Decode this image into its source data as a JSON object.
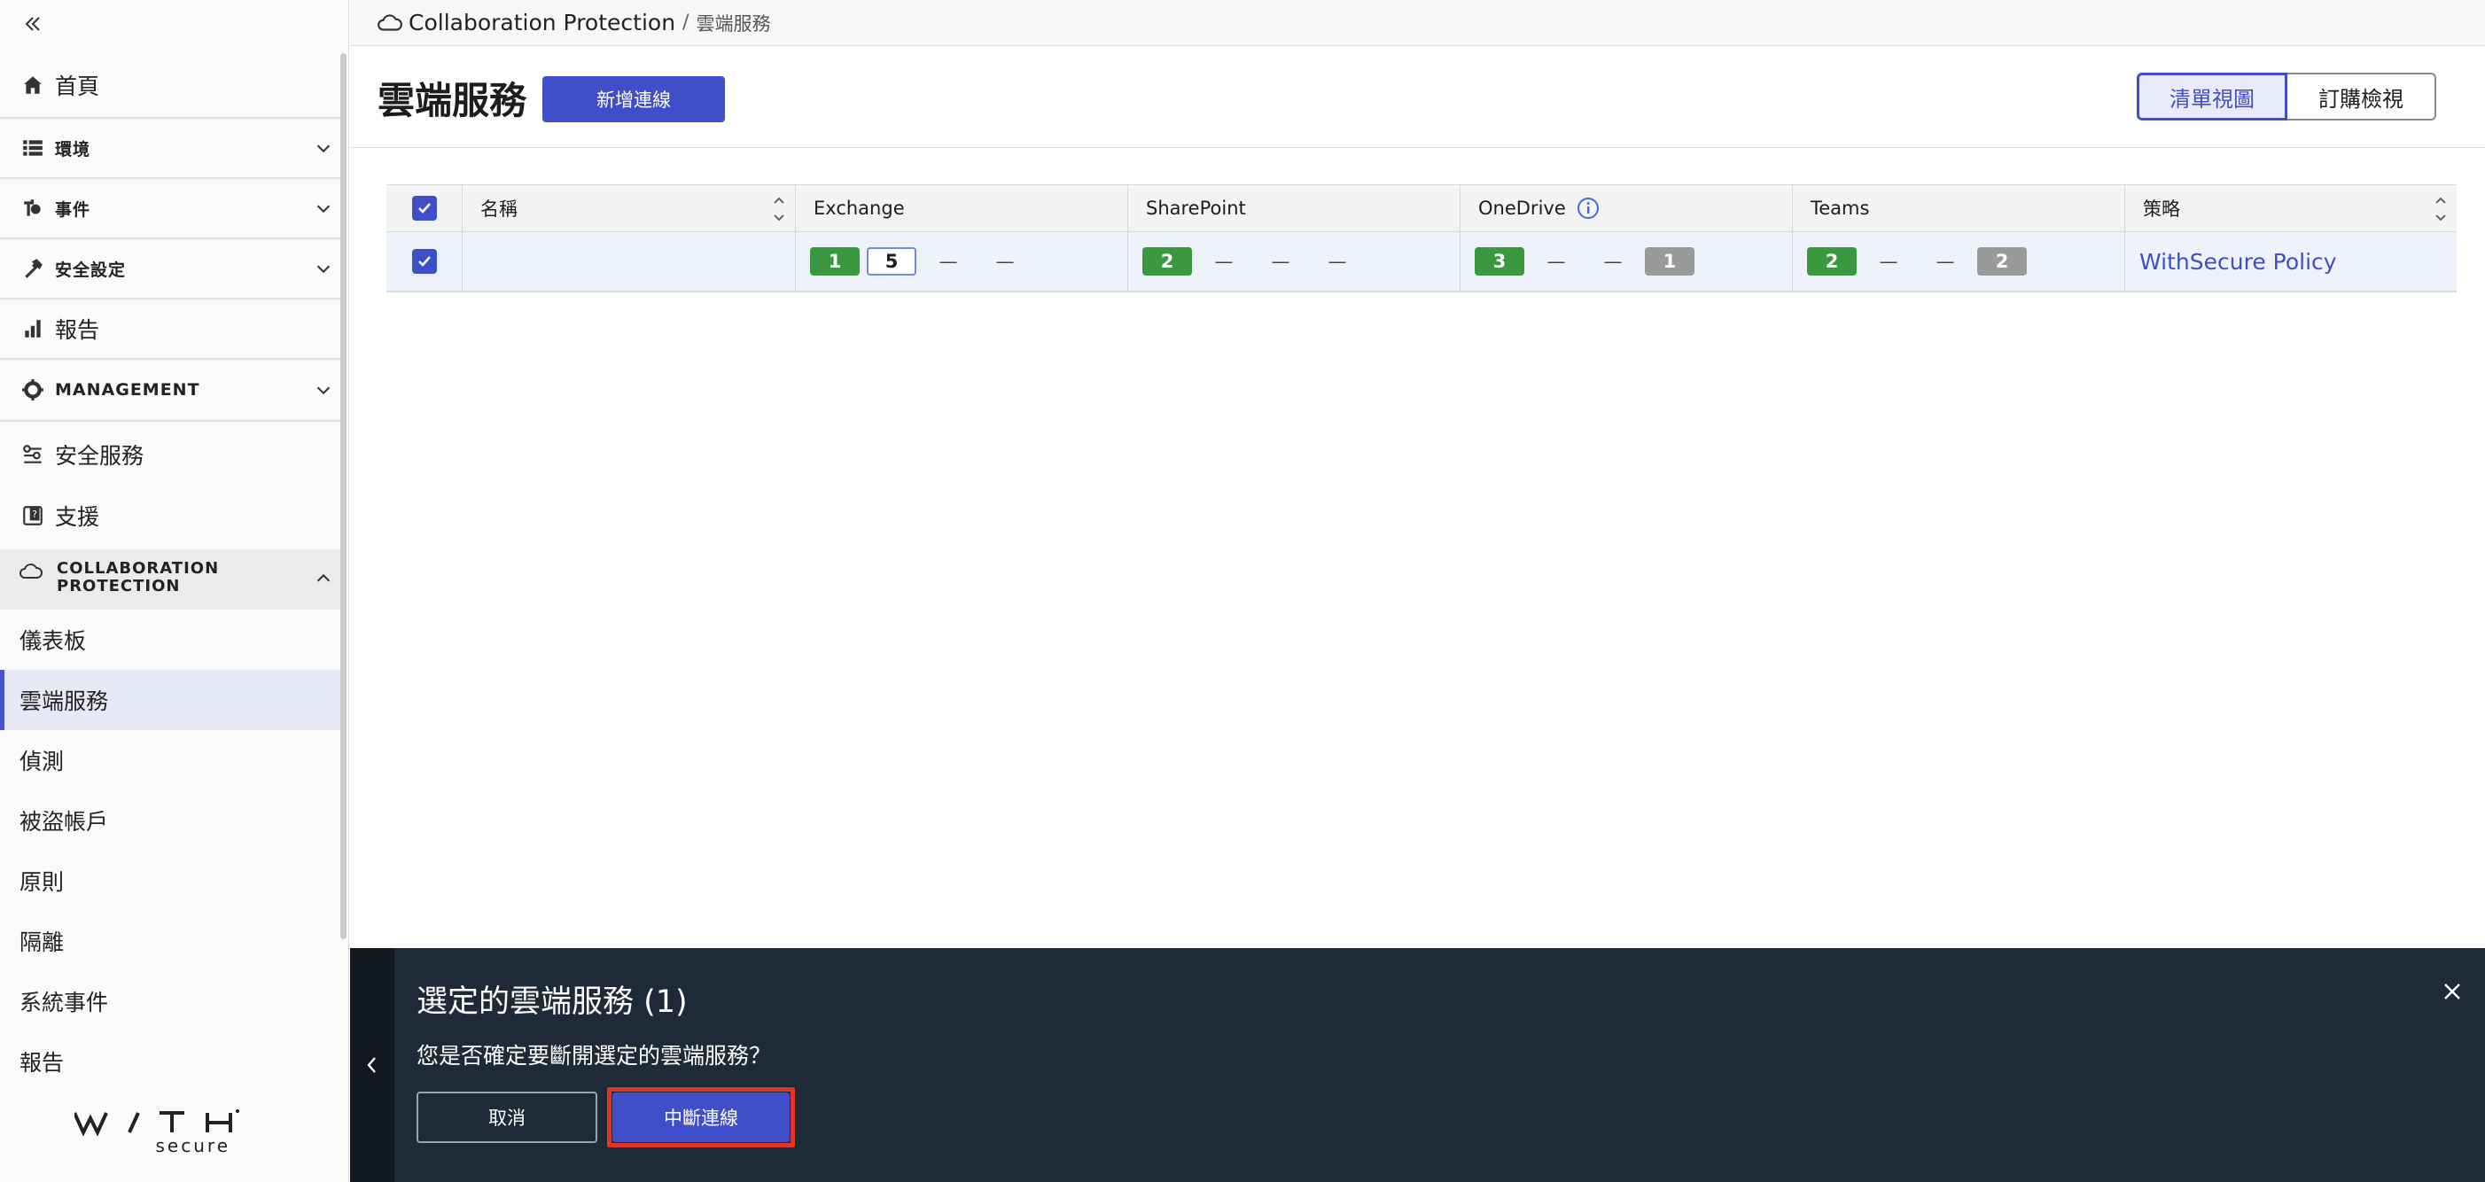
{
  "sidebar": {
    "home": "首頁",
    "env": "環境",
    "events": "事件",
    "security_settings": "安全設定",
    "reports": "報告",
    "management": "MANAGEMENT",
    "security_services": "安全服務",
    "support": "支援",
    "collab_header": "COLLABORATION PROTECTION",
    "collab_items": [
      "儀表板",
      "雲端服務",
      "偵測",
      "被盜帳戶",
      "原則",
      "隔離",
      "系統事件",
      "報告"
    ],
    "active_item": "雲端服務",
    "logo_text": "WITH",
    "logo_sub": "secure"
  },
  "breadcrumb": {
    "root": "Collaboration Protection",
    "separator": "/",
    "current": "雲端服務"
  },
  "header": {
    "title": "雲端服務",
    "add_button": "新增連線",
    "view_list": "清單視圖",
    "view_subscription": "訂購檢視"
  },
  "table": {
    "columns": [
      "名稱",
      "Exchange",
      "SharePoint",
      "OneDrive",
      "Teams",
      "策略"
    ],
    "rows": [
      {
        "checked": true,
        "name": "",
        "exchange": [
          "1",
          "5",
          "—",
          "—"
        ],
        "sharepoint": [
          "2",
          "—",
          "—",
          "—"
        ],
        "onedrive": [
          "3",
          "—",
          "—",
          "1"
        ],
        "teams": [
          "2",
          "—",
          "—",
          "2"
        ],
        "policy": "WithSecure Policy"
      }
    ]
  },
  "panel": {
    "title": "選定的雲端服務 (1)",
    "message": "您是否確定要斷開選定的雲端服務？",
    "cancel": "取消",
    "disconnect": "中斷連線"
  },
  "colors": {
    "accent": "#3f4fc9",
    "badge_green": "#3a993e",
    "badge_grey": "#9a9a9a",
    "panel_bg": "#1f2a38",
    "highlight": "#e03524"
  }
}
